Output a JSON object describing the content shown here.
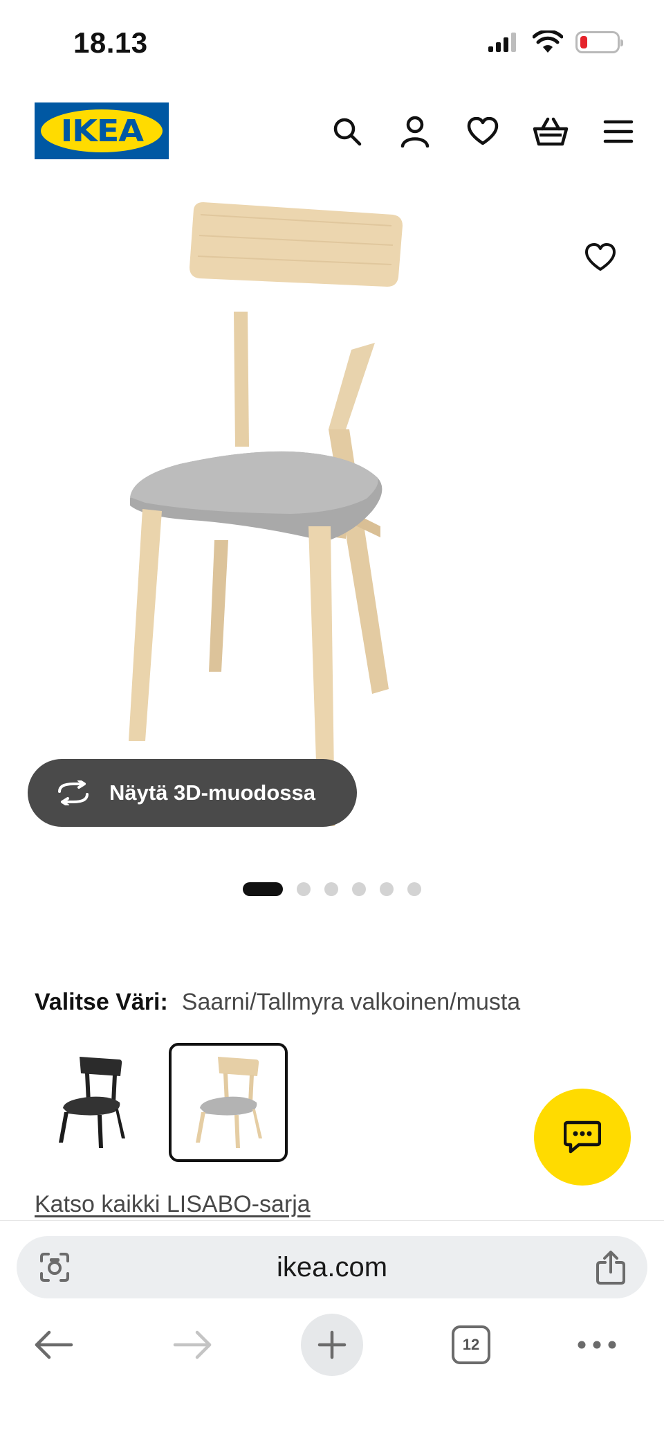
{
  "status_bar": {
    "time": "18.13",
    "signal_icon": "cellular-signal-icon",
    "wifi_icon": "wifi-icon",
    "battery_icon": "battery-low-icon",
    "battery_color": "#e5232b"
  },
  "header": {
    "logo_text": "IKEA",
    "logo_colors": {
      "blue": "#0058a3",
      "yellow": "#ffdb00"
    },
    "icons": [
      "search-icon",
      "account-icon",
      "favorites-icon",
      "cart-icon",
      "menu-icon"
    ]
  },
  "product_media": {
    "image_alt": "LISABO chair, ash / Tallmyra white/black seat",
    "favorite_icon": "heart-icon",
    "view_3d_label": "Näytä 3D-muodossa",
    "view_3d_icon": "rotate-3d-icon",
    "carousel": {
      "total": 6,
      "active_index": 0
    }
  },
  "color_selection": {
    "label": "Valitse Väri:",
    "value": "Saarni/Tallmyra valkoinen/musta",
    "swatches": [
      {
        "name": "black chair",
        "selected": false
      },
      {
        "name": "ash with grey seat",
        "selected": true
      }
    ]
  },
  "series_link": "Katso kaikki LISABO-sarja",
  "chat_fab": {
    "icon": "chat-icon",
    "color": "#ffdb00"
  },
  "browser": {
    "url": "ikea.com",
    "left_icon": "camera-lens-icon",
    "right_icon": "share-icon",
    "nav": {
      "back_icon": "back-arrow-icon",
      "forward_icon": "forward-arrow-icon",
      "new_tab_icon": "plus-icon",
      "tab_count": "12",
      "more_icon": "more-dots-icon"
    }
  }
}
